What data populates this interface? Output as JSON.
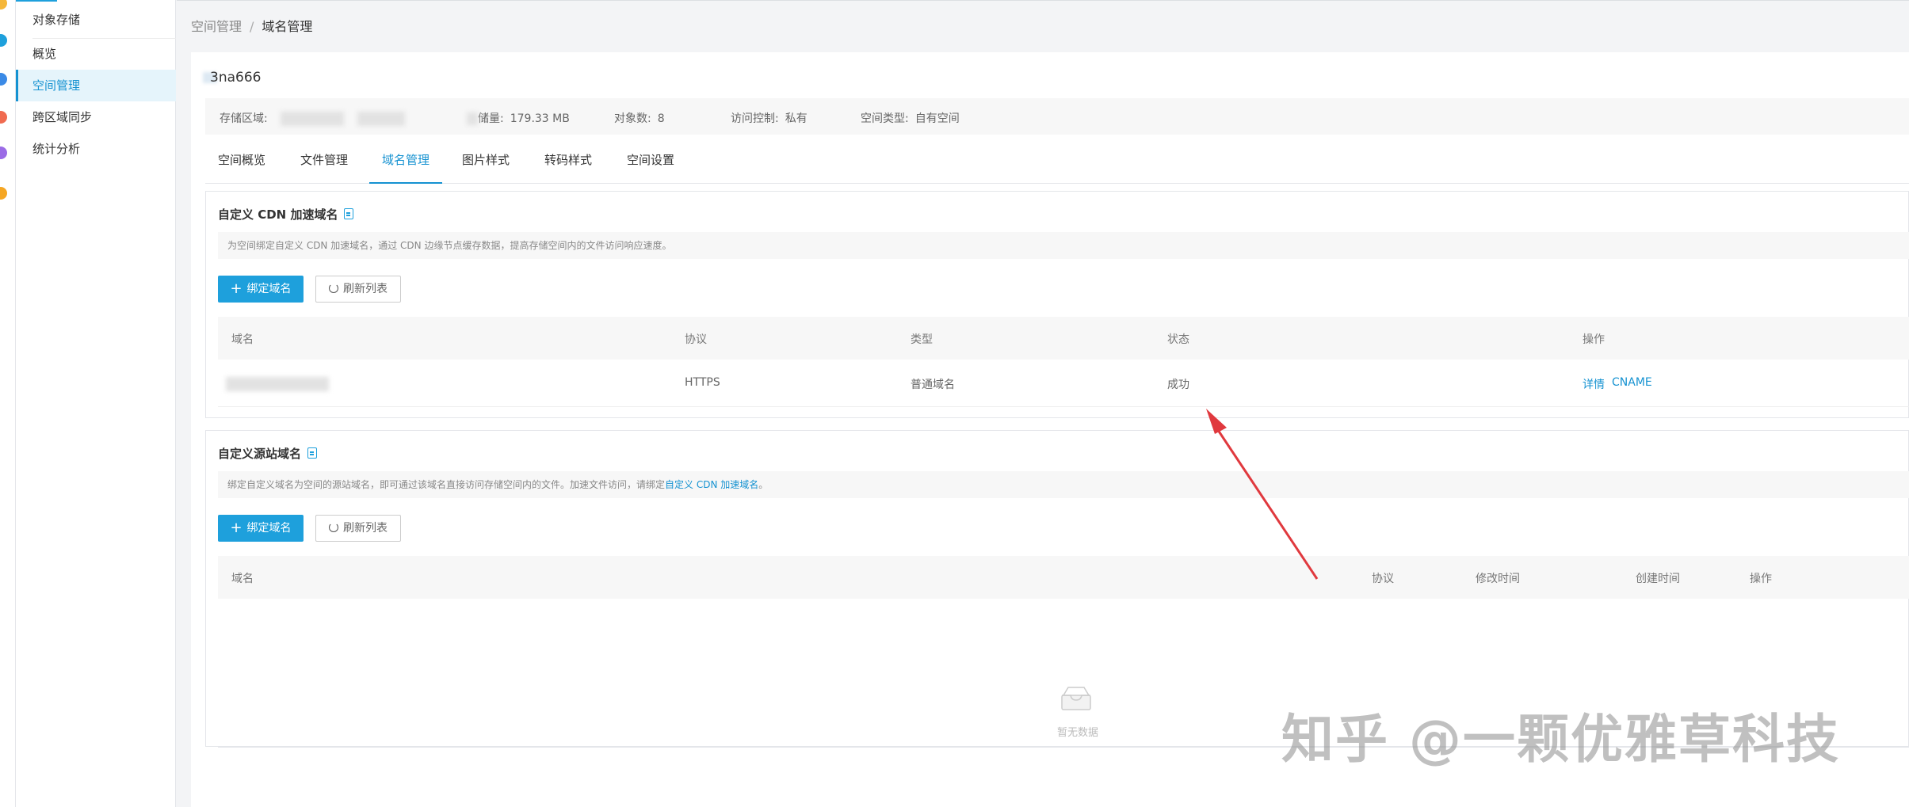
{
  "sidebar": {
    "items": [
      {
        "label": "对象存储"
      },
      {
        "label": "概览"
      },
      {
        "label": "空间管理"
      },
      {
        "label": "跨区域同步"
      },
      {
        "label": "统计分析"
      }
    ]
  },
  "breadcrumb": {
    "parent": "空间管理",
    "separator": "/",
    "current": "域名管理"
  },
  "bucket": {
    "name": "3na666"
  },
  "info": {
    "region_label": "存储区域:",
    "storage_label": "储量:",
    "storage_value": "179.33 MB",
    "objects_label": "对象数:",
    "objects_value": "8",
    "access_label": "访问控制:",
    "access_value": "私有",
    "type_label": "空间类型:",
    "type_value": "自有空间"
  },
  "tabs": [
    {
      "label": "空间概览"
    },
    {
      "label": "文件管理"
    },
    {
      "label": "域名管理"
    },
    {
      "label": "图片样式"
    },
    {
      "label": "转码样式"
    },
    {
      "label": "空间设置"
    }
  ],
  "cdn_section": {
    "title": "自定义 CDN 加速域名",
    "desc": "为空间绑定自定义 CDN 加速域名，通过 CDN 边缘节点缓存数据，提高存储空间内的文件访问响应速度。",
    "bind_button": "绑定域名",
    "refresh_button": "刷新列表",
    "headers": {
      "domain": "域名",
      "protocol": "协议",
      "type": "类型",
      "status": "状态",
      "ops": "操作"
    },
    "row": {
      "protocol": "HTTPS",
      "type": "普通域名",
      "status": "成功",
      "detail": "详情",
      "cname": "CNAME"
    }
  },
  "origin_section": {
    "title": "自定义源站域名",
    "desc_prefix": "绑定自定义域名为空间的源站域名，即可通过该域名直接访问存储空间内的文件。加速文件访问，请绑定",
    "desc_link": "自定义 CDN 加速域名",
    "desc_suffix": "。",
    "bind_button": "绑定域名",
    "refresh_button": "刷新列表",
    "headers": {
      "domain": "域名",
      "protocol": "协议",
      "modified": "修改时间",
      "created": "创建时间",
      "ops": "操作"
    },
    "empty": "暂无数据"
  },
  "watermark": "知乎 @一颗优雅草科技",
  "colors": {
    "accent": "#1ea0dc",
    "arrow": "#e0393e"
  }
}
